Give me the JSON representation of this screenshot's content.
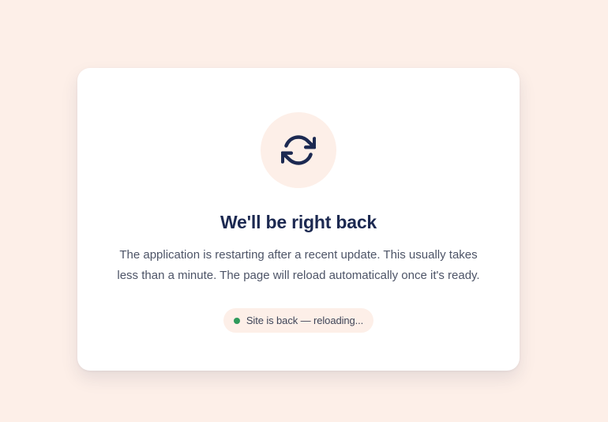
{
  "card": {
    "icon": "refresh-icon",
    "title": "We'll be right back",
    "message": "The application is restarting after a recent update. This usually takes less than a minute. The page will reload automatically once it's ready."
  },
  "status": {
    "text": "Site is back — reloading...",
    "indicator_color": "#2f9a5c"
  },
  "colors": {
    "page_background": "#fdefe8",
    "card_background": "#ffffff",
    "accent_background": "#fdefe8",
    "title": "#1c2951",
    "body_text": "#4d5467",
    "icon": "#1c2951"
  }
}
